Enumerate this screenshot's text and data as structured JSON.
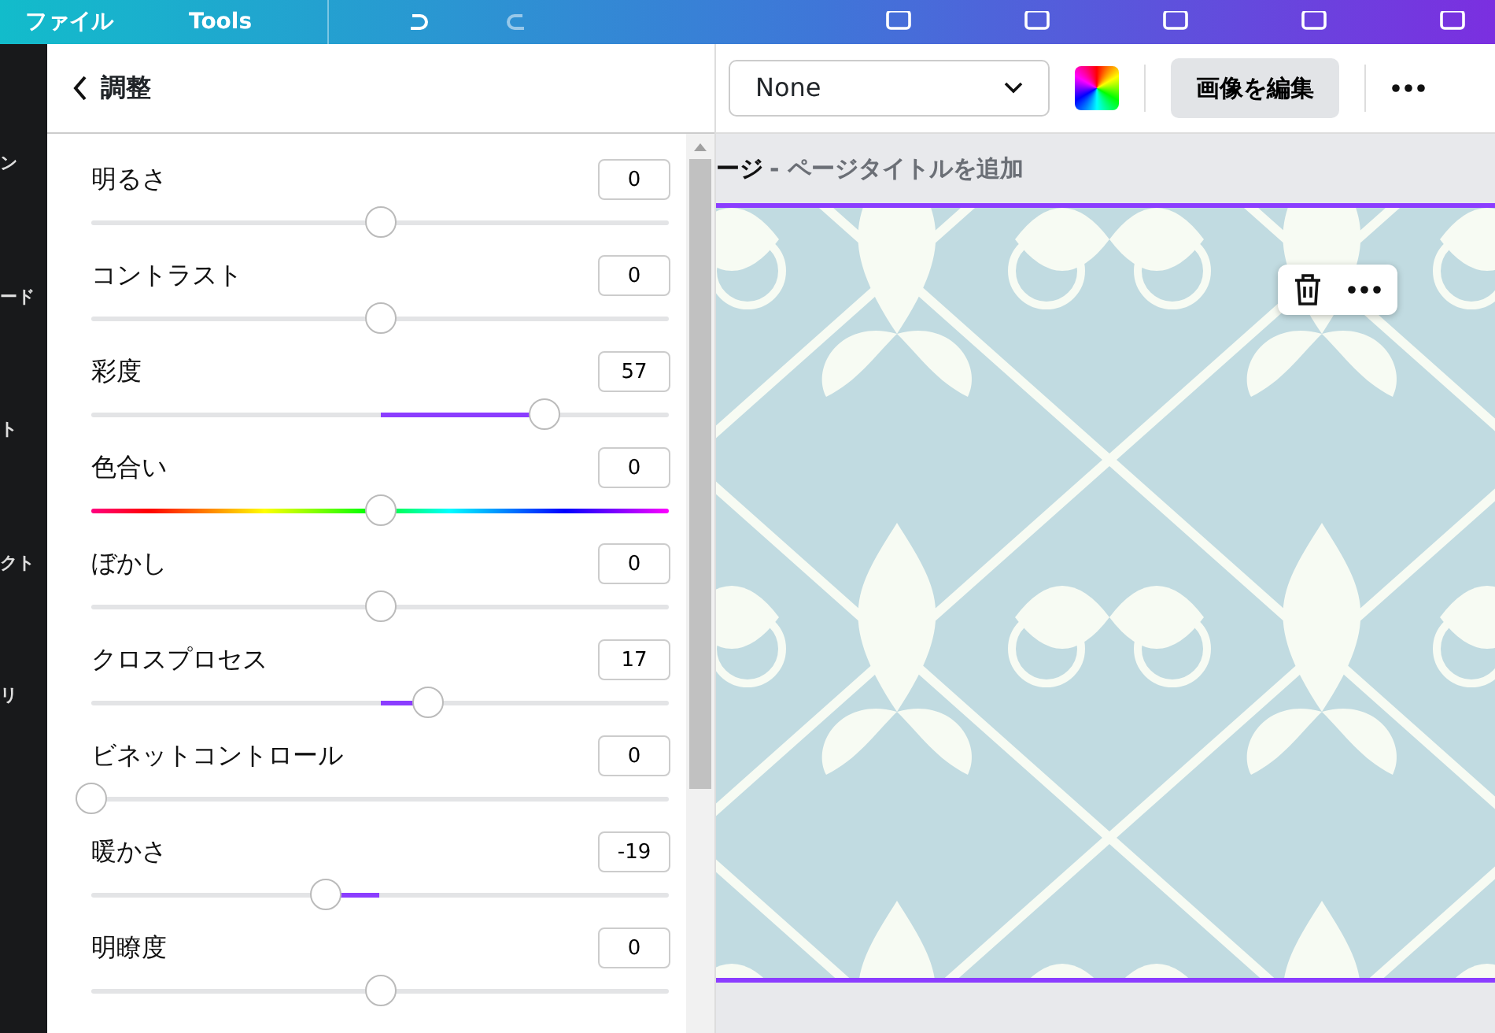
{
  "topbar": {
    "menu": [
      {
        "label": "ファイル"
      },
      {
        "label": "Tools"
      }
    ]
  },
  "rail": {
    "items": [
      {
        "label": "ン"
      },
      {
        "label": "ード"
      },
      {
        "label": "ト"
      },
      {
        "label": "クト"
      },
      {
        "label": "リ"
      }
    ]
  },
  "panel": {
    "title": "調整",
    "sliders": [
      {
        "label": "明るさ",
        "value": "0",
        "kind": "bipolar",
        "level": 0.5
      },
      {
        "label": "コントラスト",
        "value": "0",
        "kind": "bipolar",
        "level": 0.5
      },
      {
        "label": "彩度",
        "value": "57",
        "kind": "bipolar",
        "level": 0.785
      },
      {
        "label": "色合い",
        "value": "0",
        "kind": "hue",
        "level": 0.5
      },
      {
        "label": "ぼかし",
        "value": "0",
        "kind": "bipolar",
        "level": 0.5
      },
      {
        "label": "クロスプロセス",
        "value": "17",
        "kind": "bipolar",
        "level": 0.583
      },
      {
        "label": "ビネットコントロール",
        "value": "0",
        "kind": "plain",
        "level": 0
      },
      {
        "label": "暖かさ",
        "value": "-19",
        "kind": "bipolar",
        "level": 0.406
      },
      {
        "label": "明瞭度",
        "value": "0",
        "kind": "bipolar",
        "level": 0.5
      }
    ]
  },
  "toolbar": {
    "font_select": "None",
    "edit_button": "画像を編集"
  },
  "page": {
    "title_prefix": "ージ",
    "title_placeholder": "- ページタイトルを追加"
  }
}
